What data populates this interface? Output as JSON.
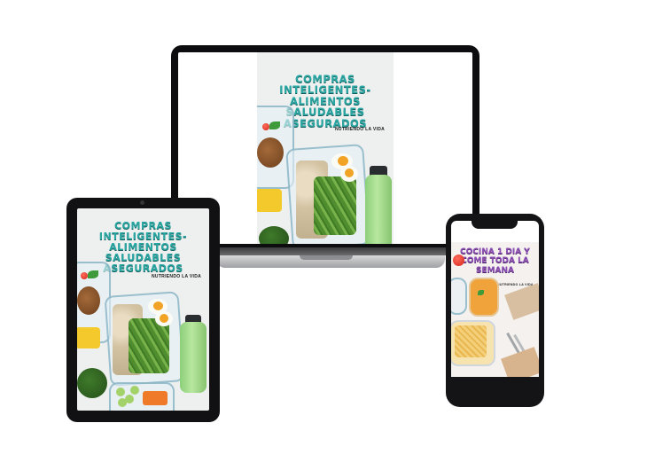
{
  "laptop_cover": {
    "title_line1": "COMPRAS INTELIGENTES-",
    "title_line2": "ALIMENTOS SALUDABLES",
    "title_line3": "ASEGURADOS",
    "author": "NUTRIENDO LA VIDA"
  },
  "tablet_cover": {
    "title_line1": "COMPRAS INTELIGENTES-",
    "title_line2": "ALIMENTOS SALUDABLES",
    "title_line3": "ASEGURADOS",
    "author": "NUTRIENDO LA VIDA"
  },
  "phone_cover": {
    "title_line1": "COCINA 1 DIA Y",
    "title_line2": "COME TODA LA",
    "title_line3": "SEMANA",
    "author": "NUTRIENDO LA VIDA"
  },
  "colors": {
    "title_teal": "#2aa7a3",
    "title_purple": "#8d4fb5",
    "device_black": "#111114"
  }
}
